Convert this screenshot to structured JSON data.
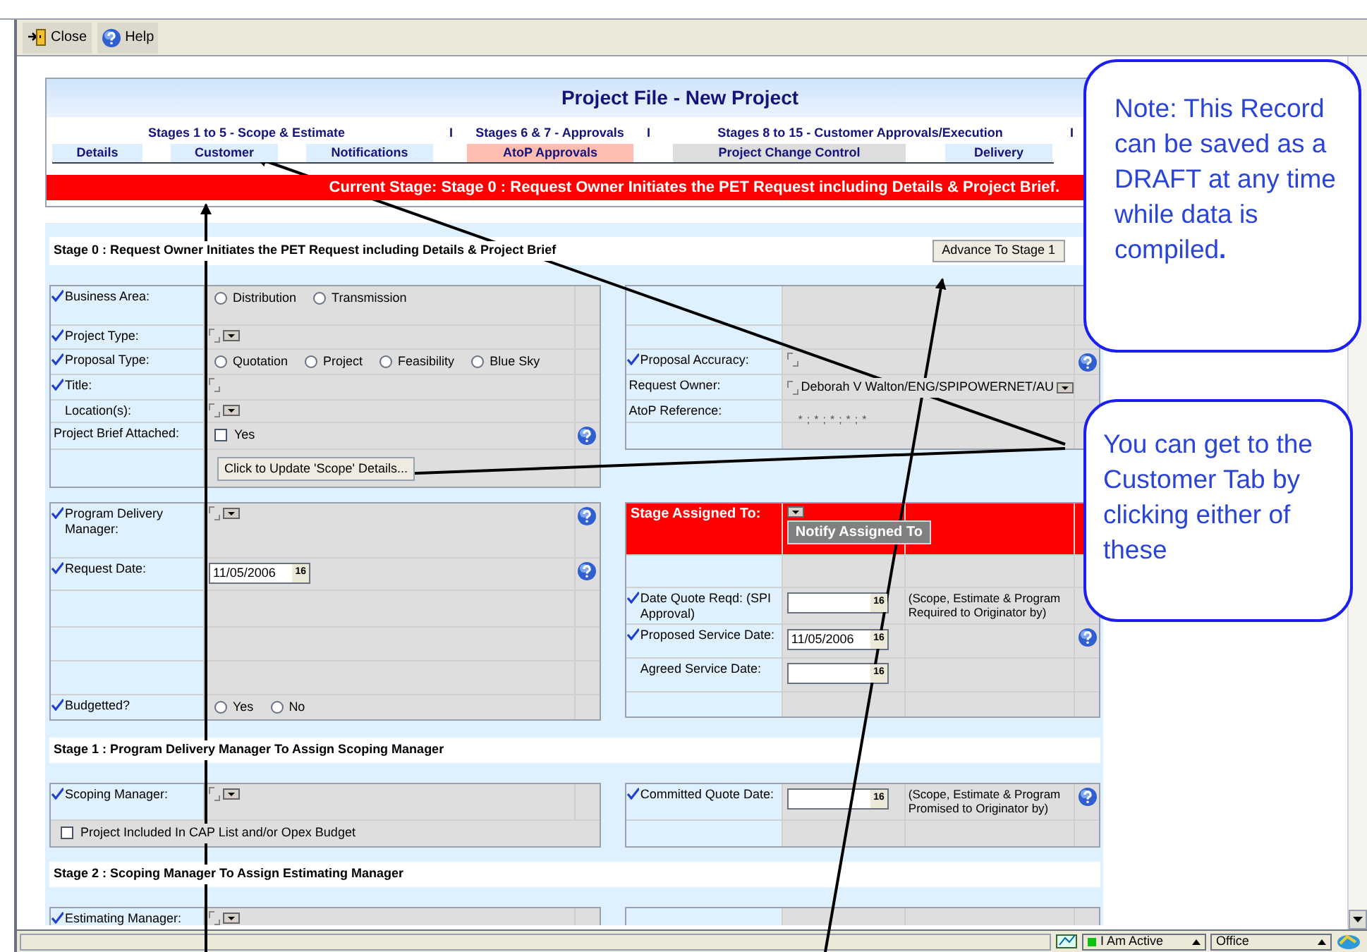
{
  "toolbar": [
    {
      "kind": "close",
      "label": "Close"
    },
    {
      "kind": "help",
      "label": "Help"
    }
  ],
  "header": {
    "title": "Project File - New Project"
  },
  "stage_groups": [
    {
      "label": "Stages 1 to 5 - Scope & Estimate",
      "divider": "I"
    },
    {
      "label": "Stages 6 & 7 - Approvals",
      "divider": "I"
    },
    {
      "label": "Stages 8 to 15 - Customer Approvals/Execution",
      "divider": "I"
    }
  ],
  "tabs": [
    {
      "label": "Details",
      "color": "#ddeeff"
    },
    {
      "label": "Customer",
      "color": "#ddeeff"
    },
    {
      "label": "Notifications",
      "color": "#ddeeff"
    },
    {
      "label": "AtoP Approvals",
      "color": "#ffbdb0"
    },
    {
      "label": "Project Change Control",
      "color": "#dddddd"
    },
    {
      "label": "Delivery",
      "color": "#ddeeff"
    }
  ],
  "current_stage": "Current Stage: Stage 0 : Request Owner Initiates the PET Request including Details & Project Brief.",
  "sections": [
    {
      "heading": "Stage 0 : Request Owner Initiates the PET Request including Details & Project Brief",
      "button": "Advance To Stage 1",
      "tables": [
        {
          "kind": "plain",
          "rows": [
            {
              "label": "Business Area:",
              "required": true,
              "help": false,
              "value": {
                "kind": "radio",
                "options": [
                  {
                    "label": "Distribution",
                    "selected": false
                  },
                  {
                    "label": "Transmission",
                    "selected": false
                  }
                ]
              }
            },
            {
              "label": "Project Type:",
              "required": true,
              "help": false,
              "value": {
                "kind": "combo"
              }
            },
            {
              "label": "Proposal Type:",
              "required": true,
              "help": false,
              "value": {
                "kind": "radio",
                "options": [
                  {
                    "label": "Quotation",
                    "selected": false
                  },
                  {
                    "label": "Project",
                    "selected": false
                  },
                  {
                    "label": "Feasibility",
                    "selected": false
                  },
                  {
                    "label": "Blue Sky",
                    "selected": false
                  }
                ]
              }
            },
            {
              "label": "Title:",
              "required": true,
              "help": false,
              "value": {
                "kind": "stub"
              }
            },
            {
              "label": "Location(s):",
              "required": false,
              "indented": true,
              "help": false,
              "value": {
                "kind": "combo"
              }
            },
            {
              "label": "Project Brief Attached:",
              "required": false,
              "help": true,
              "value": {
                "kind": "checkbox",
                "label": "Yes",
                "checked": false
              }
            },
            {
              "required": false,
              "help": false,
              "value": {
                "kind": "button",
                "label": "Click to Update 'Scope' Details..."
              }
            }
          ]
        },
        {
          "kind": "plain",
          "rows": [
            {
              "required": false,
              "help": false
            },
            {
              "required": false,
              "help": false
            },
            {
              "label": "Proposal Accuracy:",
              "required": true,
              "help": true,
              "value": {
                "kind": "stub"
              }
            },
            {
              "label": "Request Owner:",
              "required": false,
              "help": false,
              "value": {
                "kind": "combo",
                "value": "Deborah V Walton/ENG/SPIPOWERNET/AU"
              }
            },
            {
              "label": "AtoP Reference:",
              "required": false,
              "help": false,
              "value": {
                "kind": "text",
                "value": "*;*;*;*;*"
              }
            },
            {
              "required": false,
              "help": false
            }
          ]
        }
      ]
    },
    {
      "tables": [
        {
          "kind": "plain",
          "rows": [
            {
              "label": "Program Delivery Manager:",
              "required": true,
              "help": true,
              "value": {
                "kind": "combo"
              }
            },
            {
              "label": "Request Date:",
              "required": true,
              "help": true,
              "value": {
                "kind": "date",
                "value": "11/05/2006",
                "calendar": "16"
              }
            },
            {
              "required": false,
              "help": false
            },
            {
              "required": false,
              "help": false
            },
            {
              "required": false,
              "help": false
            },
            {
              "label": "Budgetted?",
              "required": true,
              "help": false,
              "value": {
                "kind": "radio",
                "options": [
                  {
                    "label": "Yes",
                    "selected": false
                  },
                  {
                    "label": "No",
                    "selected": false
                  }
                ]
              }
            }
          ]
        },
        {
          "kind": "with_note",
          "rows": [
            {
              "label": "Stage Assigned To:",
              "required": false,
              "alert": true,
              "help": false,
              "value": {
                "kind": "assign",
                "button": "Notify Assigned To"
              }
            },
            {
              "required": false,
              "help": false
            },
            {
              "label": "Date Quote Reqd: (SPI Approval)",
              "required": true,
              "help": false,
              "value": {
                "kind": "date",
                "calendar": "16"
              },
              "note": "(Scope, Estimate & Program Required to Originator by)"
            },
            {
              "label": "Proposed Service Date:",
              "required": true,
              "help": true,
              "value": {
                "kind": "date",
                "value": "11/05/2006",
                "calendar": "16"
              }
            },
            {
              "label": "Agreed Service Date:",
              "required": false,
              "indented": true,
              "help": false,
              "value": {
                "kind": "date",
                "calendar": "16"
              }
            },
            {
              "required": false,
              "help": false
            }
          ]
        }
      ]
    },
    {
      "heading": "Stage 1 : Program Delivery Manager To Assign Scoping Manager",
      "tables": [
        {
          "kind": "plain",
          "rows": [
            {
              "label": "Scoping Manager:",
              "required": true,
              "help": false,
              "value": {
                "kind": "combo"
              }
            },
            {
              "required": false,
              "help": false,
              "span": true,
              "value": {
                "kind": "checkbox",
                "label": "Project Included In CAP List and/or Opex Budget",
                "checked": false
              }
            }
          ]
        },
        {
          "kind": "with_note",
          "rows": [
            {
              "label": "Committed Quote Date:",
              "required": true,
              "help": true,
              "value": {
                "kind": "date",
                "calendar": "16"
              },
              "note": "(Scope, Estimate & Program Promised to Originator by)"
            },
            {
              "required": false,
              "help": false
            }
          ]
        }
      ]
    },
    {
      "heading": "Stage 2 : Scoping Manager To Assign Estimating Manager",
      "tables": [
        {
          "kind": "plain",
          "rows": [
            {
              "label": "Estimating Manager:",
              "required": true,
              "help": false,
              "value": {
                "kind": "combo"
              }
            }
          ]
        },
        {
          "kind": "with_note",
          "rows": [
            {
              "required": false,
              "help": false
            }
          ]
        }
      ]
    }
  ],
  "status_bar": [
    {
      "kind": "presence",
      "label": "I Am Active"
    },
    {
      "kind": "plain",
      "label": "Office"
    }
  ],
  "callouts": [
    {
      "text": "Note: This Record can be saved as a DRAFT at any time while data is compiled**.**"
    },
    {
      "text": "You can get to the Customer Tab by clicking either of these"
    }
  ]
}
